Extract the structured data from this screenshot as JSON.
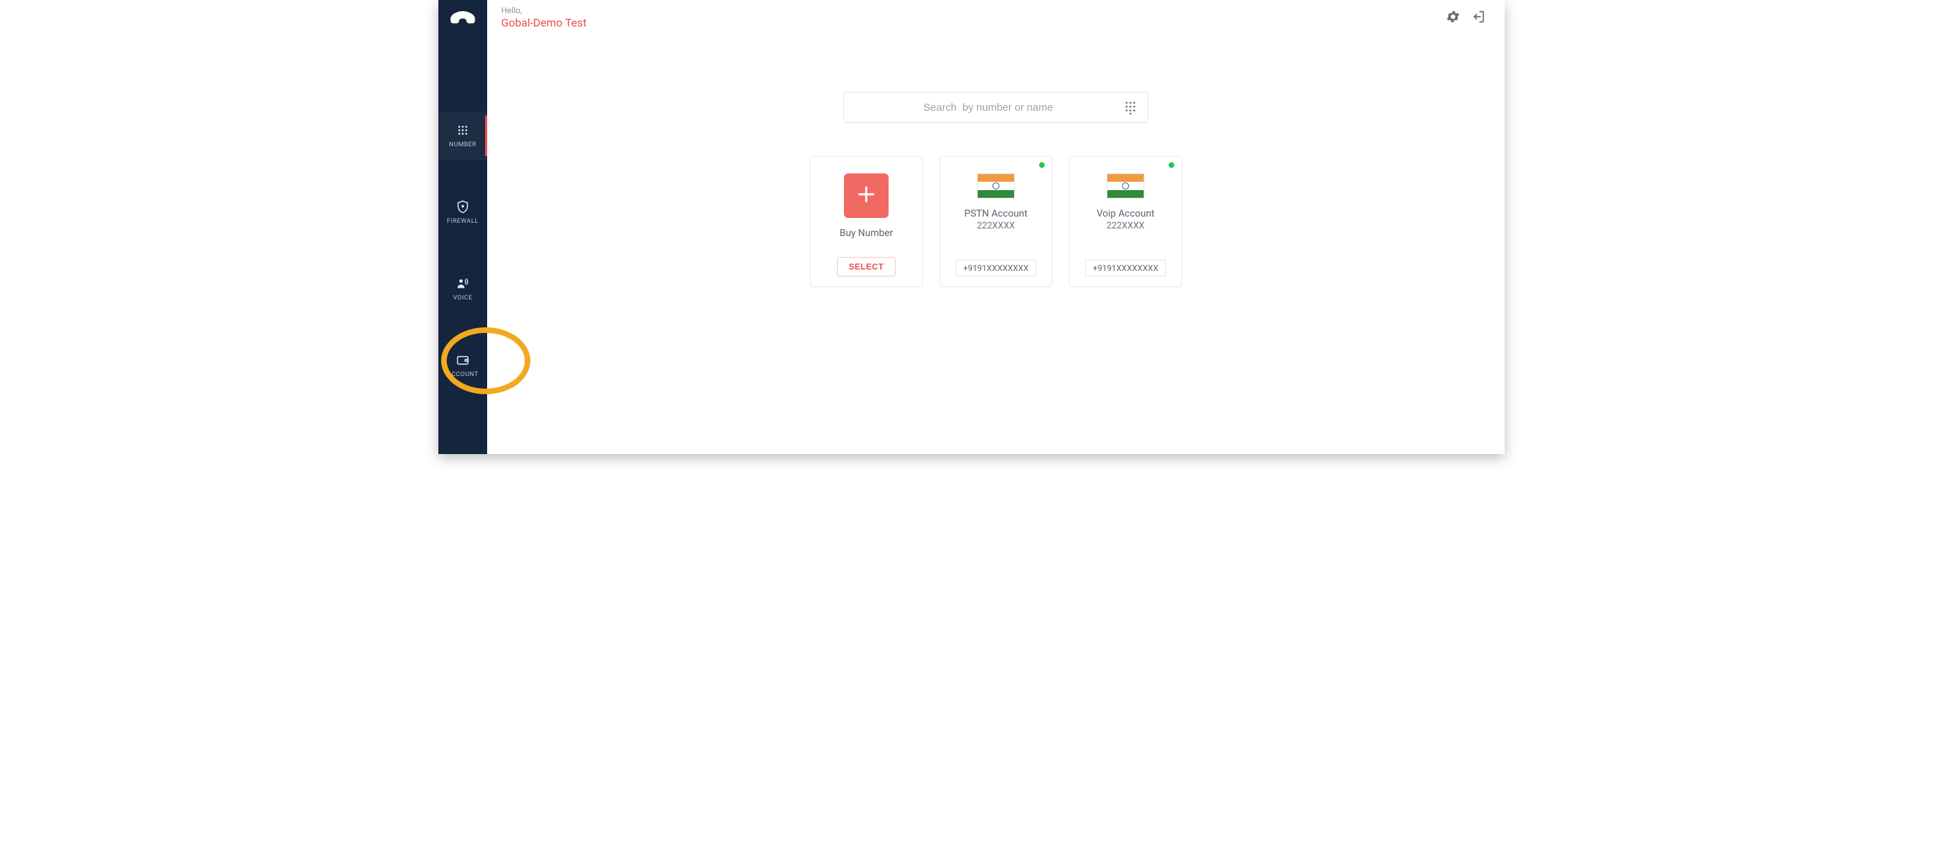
{
  "sidebar": {
    "items": [
      {
        "key": "number",
        "label": "NUMBER",
        "icon": "dialpad-icon",
        "active": true
      },
      {
        "key": "firewall",
        "label": "FIREWALL",
        "icon": "shield-icon",
        "active": false
      },
      {
        "key": "voice",
        "label": "VOICE",
        "icon": "voice-icon",
        "active": false
      },
      {
        "key": "account",
        "label": "ACCOUNT",
        "icon": "wallet-icon",
        "active": false
      }
    ]
  },
  "header": {
    "greeting": "Hello,",
    "user_name": "Gobal-Demo Test"
  },
  "search": {
    "placeholder": "Search  by number or name"
  },
  "cards": {
    "buy": {
      "title": "Buy Number",
      "button": "SELECT"
    },
    "accounts": [
      {
        "title": "PSTN Account",
        "subtitle": "222XXXX",
        "phone": "+9191XXXXXXXX",
        "country": "india",
        "status": "online"
      },
      {
        "title": "Voip Account",
        "subtitle": "222XXXX",
        "phone": "+9191XXXXXXXX",
        "country": "india",
        "status": "online"
      }
    ]
  },
  "colors": {
    "accent": "#ef4a4a",
    "sidebar": "#14253d",
    "highlight": "#f2a91f"
  }
}
